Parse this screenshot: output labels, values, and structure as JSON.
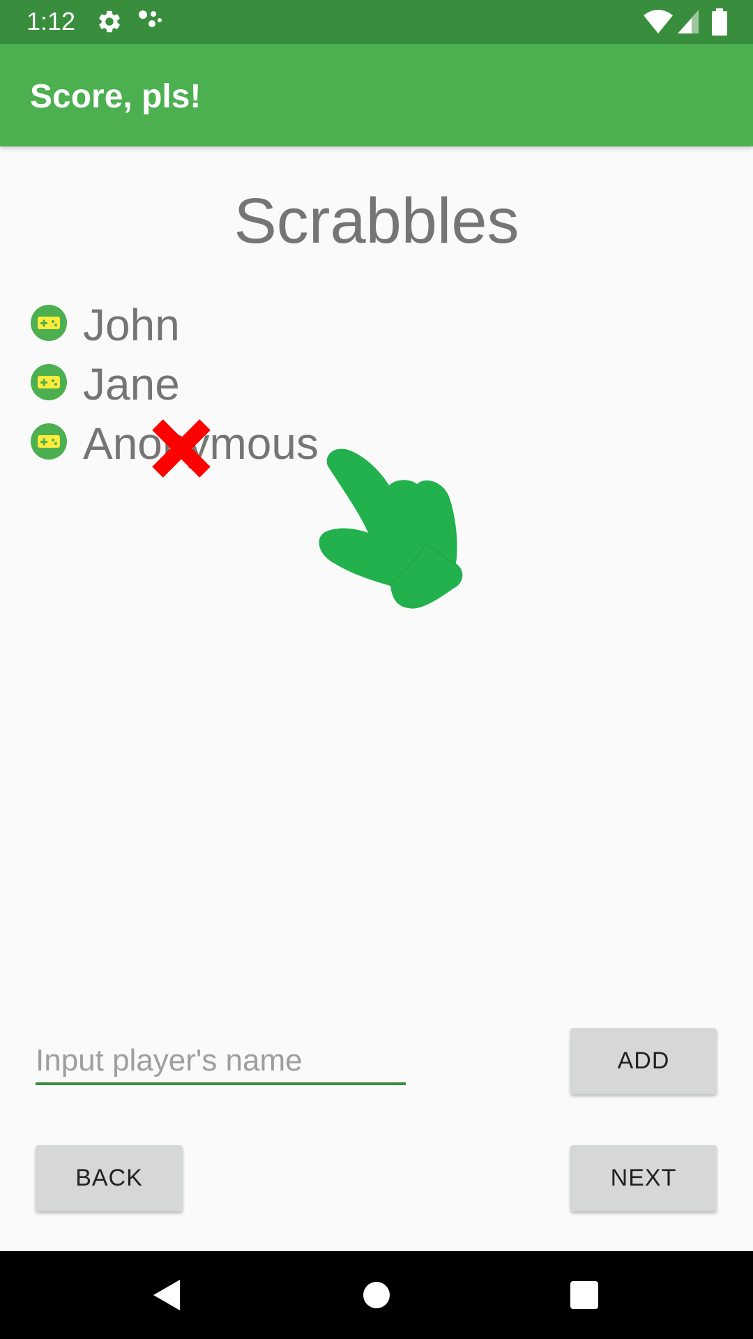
{
  "status_bar": {
    "time": "1:12",
    "icons": [
      "settings-icon",
      "assistant-icon",
      "wifi-icon",
      "signal-icon",
      "battery-icon"
    ]
  },
  "app_bar": {
    "title": "Score, pls!"
  },
  "game": {
    "title": "Scrabbles"
  },
  "players": [
    {
      "name": "John",
      "icon": "gamepad-icon"
    },
    {
      "name": "Jane",
      "icon": "gamepad-icon"
    },
    {
      "name": "Anonymous",
      "icon": "gamepad-icon"
    }
  ],
  "overlay": {
    "remove_icon": "close-icon",
    "pointer_icon": "pointing-hand-icon"
  },
  "input": {
    "placeholder": "Input player's name",
    "value": ""
  },
  "buttons": {
    "add": "ADD",
    "back": "BACK",
    "next": "NEXT"
  },
  "colors": {
    "status_bar": "#388e3c",
    "app_bar": "#4caf50",
    "accent": "#388e3c",
    "remove": "#ff0000",
    "pointer": "#22b14c",
    "icon_yellow": "#ffeb3b"
  }
}
